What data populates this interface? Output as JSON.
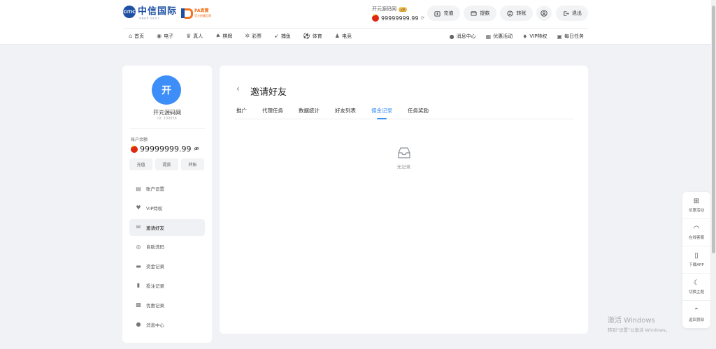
{
  "brand": {
    "logo_text": "中信国际",
    "logo_tagline": "中信在手 行走天下",
    "partner_title": "PA真實",
    "partner_sub": "官方授權品牌"
  },
  "user": {
    "name": "开元源码网",
    "vip_badge": "VIP",
    "balance": "99999999.99",
    "id": "ID: 100056",
    "avatar_char": "开"
  },
  "header_buttons": [
    {
      "label": "充值",
      "icon": "deposit-icon"
    },
    {
      "label": "提款",
      "icon": "withdraw-icon"
    },
    {
      "label": "转账",
      "icon": "transfer-icon"
    },
    {
      "label": "",
      "icon": "user-profile-icon"
    },
    {
      "label": "退出",
      "icon": "logout-icon"
    }
  ],
  "nav": {
    "left": [
      {
        "label": "首页",
        "icon": "home-icon"
      },
      {
        "label": "电子",
        "icon": "slots-icon"
      },
      {
        "label": "真人",
        "icon": "live-casino-icon"
      },
      {
        "label": "棋牌",
        "icon": "cards-icon"
      },
      {
        "label": "彩票",
        "icon": "lottery-icon"
      },
      {
        "label": "捕鱼",
        "icon": "fishing-icon"
      },
      {
        "label": "体育",
        "icon": "sports-icon"
      },
      {
        "label": "电竞",
        "icon": "esports-icon"
      }
    ],
    "right": [
      {
        "label": "消息中心",
        "icon": "message-icon"
      },
      {
        "label": "优惠活动",
        "icon": "promo-icon"
      },
      {
        "label": "VIP特权",
        "icon": "vip-icon"
      },
      {
        "label": "每日任务",
        "icon": "task-icon"
      }
    ]
  },
  "sidebar": {
    "balance_label": "账户余额",
    "quick_buttons": [
      "充值",
      "提款",
      "转账"
    ],
    "menu": [
      {
        "label": "账户设置",
        "icon": "id-card-icon",
        "active": false
      },
      {
        "label": "VIP特权",
        "icon": "diamond-icon",
        "active": false
      },
      {
        "label": "邀请好友",
        "icon": "invite-icon",
        "active": true
      },
      {
        "label": "自助洗码",
        "icon": "chip-icon",
        "active": false
      },
      {
        "label": "资金记录",
        "icon": "wallet-icon",
        "active": false
      },
      {
        "label": "投注记录",
        "icon": "clipboard-icon",
        "active": false
      },
      {
        "label": "优惠记录",
        "icon": "gift-icon",
        "active": false
      },
      {
        "label": "消息中心",
        "icon": "chat-icon",
        "active": false
      }
    ]
  },
  "main": {
    "title": "邀请好友",
    "tabs": [
      {
        "label": "推广",
        "active": false
      },
      {
        "label": "代理任务",
        "active": false
      },
      {
        "label": "数据统计",
        "active": false
      },
      {
        "label": "好友列表",
        "active": false
      },
      {
        "label": "佣金记录",
        "active": true
      },
      {
        "label": "任务奖励",
        "active": false
      }
    ],
    "empty_text": "无记录"
  },
  "float_bar": [
    {
      "label": "优惠活动",
      "icon": "gift-icon"
    },
    {
      "label": "在线客服",
      "icon": "headset-icon"
    },
    {
      "label": "下载APP",
      "icon": "phone-icon"
    },
    {
      "label": "切换主题",
      "icon": "moon-icon"
    },
    {
      "label": "返回顶部",
      "icon": "arrow-up-icon"
    }
  ],
  "watermark": {
    "title": "激活 Windows",
    "subtitle": "转到\"设置\"以激活 Windows。"
  },
  "colors": {
    "accent": "#3d8ef8",
    "page_bg": "#f1f2f5",
    "brand_blue": "#1d4fa3",
    "partner_orange": "#f37321"
  }
}
